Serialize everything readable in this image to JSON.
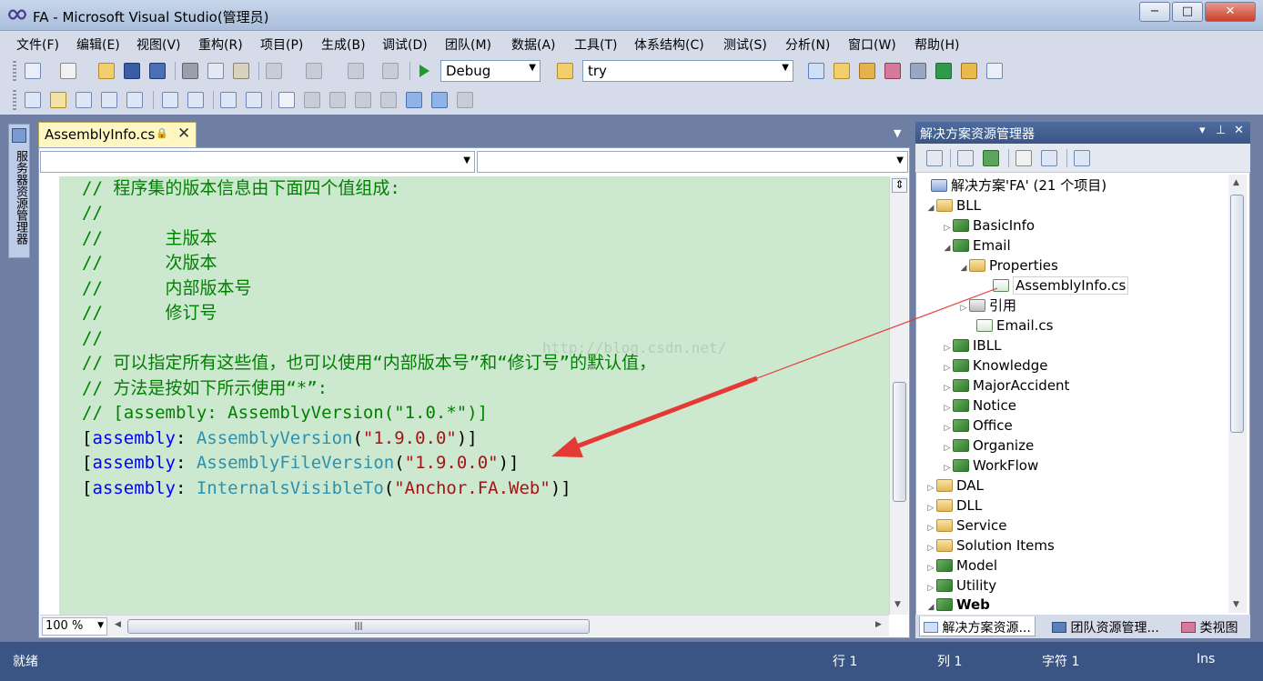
{
  "window": {
    "title": "FA - Microsoft Visual Studio(管理员)",
    "min_label": "−",
    "max_label": "□",
    "close_label": "✕"
  },
  "menu": [
    "文件(F)",
    "编辑(E)",
    "视图(V)",
    "重构(R)",
    "项目(P)",
    "生成(B)",
    "调试(D)",
    "团队(M)",
    "数据(A)",
    "工具(T)",
    "体系结构(C)",
    "测试(S)",
    "分析(N)",
    "窗口(W)",
    "帮助(H)"
  ],
  "toolbar": {
    "config": "Debug",
    "find": "try"
  },
  "left_strip": {
    "label": "服务器资源管理器"
  },
  "editor": {
    "tab_title": "AssemblyInfo.cs",
    "tab_lock": "🔒",
    "tab_close": "✕",
    "zoom": "100 %",
    "lines": {
      "l1": "// 程序集的版本信息由下面四个值组成:",
      "l2": "//",
      "l3": "//      主版本",
      "l4": "//      次版本",
      "l5": "//      内部版本号",
      "l6": "//      修订号",
      "l7": "//",
      "l8": "// 可以指定所有这些值，也可以使用“内部版本号”和“修订号”的默认值，",
      "l9": "// 方法是按如下所示使用“*”:",
      "l10": "// [assembly: AssemblyVersion(\"1.0.*\")]"
    },
    "attrs": [
      {
        "kw": "assembly",
        "type": "AssemblyVersion",
        "arg": "\"1.9.0.0\""
      },
      {
        "kw": "assembly",
        "type": "AssemblyFileVersion",
        "arg": "\"1.9.0.0\""
      },
      {
        "kw": "assembly",
        "type": "InternalsVisibleTo",
        "arg": "\"Anchor.FA.Web\""
      }
    ],
    "watermark": "http://blog.csdn.net/"
  },
  "solution_explorer": {
    "title": "解决方案资源管理器",
    "pin": "▾ ⊥ ✕",
    "tree": [
      {
        "label": "解决方案'FA' (21 个项目)",
        "icon": "solution-icon"
      },
      {
        "label": "BLL",
        "icon": "folder-icon"
      },
      {
        "label": "BasicInfo",
        "icon": "project-icon"
      },
      {
        "label": "Email",
        "icon": "project-icon"
      },
      {
        "label": "Properties",
        "icon": "folder-icon"
      },
      {
        "label": "AssemblyInfo.cs",
        "icon": "cs-file-icon"
      },
      {
        "label": "引用",
        "icon": "references-icon"
      },
      {
        "label": "Email.cs",
        "icon": "cs-file-icon"
      },
      {
        "label": "IBLL",
        "icon": "project-icon"
      },
      {
        "label": "Knowledge",
        "icon": "project-icon"
      },
      {
        "label": "MajorAccident",
        "icon": "project-icon"
      },
      {
        "label": "Notice",
        "icon": "project-icon"
      },
      {
        "label": "Office",
        "icon": "project-icon"
      },
      {
        "label": "Organize",
        "icon": "project-icon"
      },
      {
        "label": "WorkFlow",
        "icon": "project-icon"
      },
      {
        "label": "DAL",
        "icon": "folder-icon"
      },
      {
        "label": "DLL",
        "icon": "folder-icon"
      },
      {
        "label": "Service",
        "icon": "folder-icon"
      },
      {
        "label": "Solution Items",
        "icon": "folder-icon"
      },
      {
        "label": "Model",
        "icon": "project-icon"
      },
      {
        "label": "Utility",
        "icon": "project-icon"
      },
      {
        "label": "Web",
        "icon": "project-icon"
      }
    ],
    "tabs": [
      "解决方案资源...",
      "团队资源管理...",
      "类视图"
    ]
  },
  "status": {
    "ready": "就绪",
    "line": "行 1",
    "col": "列 1",
    "ch": "字符 1",
    "ins": "Ins"
  },
  "colors": {
    "code_background": "#cce8cf",
    "comment": "#008000",
    "keyword": "#0000ff",
    "type": "#2b91af",
    "string": "#a31515",
    "status_bar": "#3a5584",
    "arrow": "#e53935"
  }
}
